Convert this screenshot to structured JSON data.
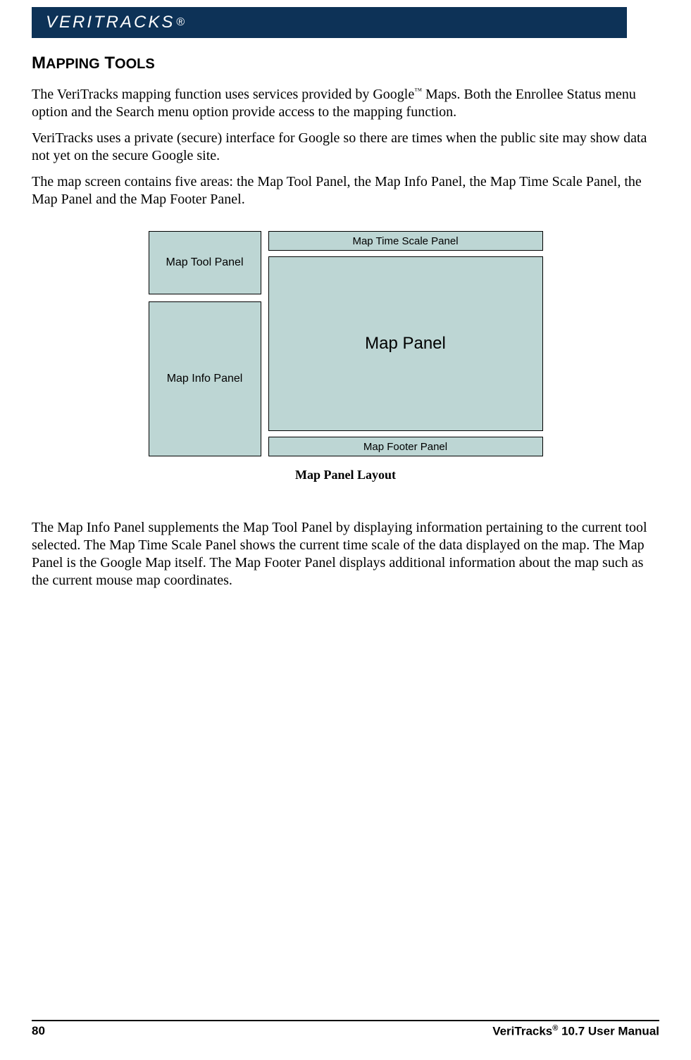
{
  "header": {
    "brand": "VERITRACKS",
    "registered": "®"
  },
  "heading": {
    "word1_first": "M",
    "word1_rest": "apping",
    "word2_first": "T",
    "word2_rest": "ools"
  },
  "paragraphs": {
    "p1a": "The VeriTracks mapping function uses services provided by Google",
    "p1_tm": "™",
    "p1b": " Maps. Both the Enrollee Status menu option and the Search menu option provide access to the mapping function.",
    "p2": "VeriTracks uses a private (secure) interface for Google so there are times when the public site may show data not yet on the secure Google site.",
    "p3": "The map screen contains five areas: the Map Tool Panel, the Map Info Panel, the Map Time Scale Panel, the Map Panel and the Map Footer Panel.",
    "p4": "The Map Info Panel supplements the Map Tool Panel by displaying information pertaining to the current tool selected. The Map Time Scale Panel shows the current time scale of the data displayed on the map. The Map Panel is the Google Map itself. The Map Footer Panel displays additional information about the map such as the current mouse map coordinates."
  },
  "diagram": {
    "tool_panel": "Map Tool Panel",
    "info_panel": "Map Info Panel",
    "time_scale": "Map Time Scale Panel",
    "map_panel": "Map Panel",
    "footer_panel": "Map Footer Panel",
    "caption": "Map Panel Layout"
  },
  "footer": {
    "page_number": "80",
    "product_name": "VeriTracks",
    "registered": "®",
    "version": " 10.7 User Manual"
  }
}
